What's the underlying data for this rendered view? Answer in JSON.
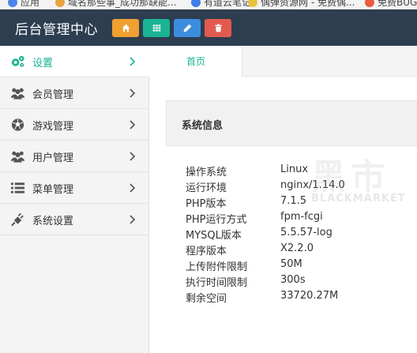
{
  "bookmarks": [
    {
      "label": "应用",
      "color": "#4a86e8"
    },
    {
      "label": "域名那些事_成功那缺能...",
      "color": "#e8a33d"
    },
    {
      "label": "有道云笔记",
      "color": "#3d7de8"
    },
    {
      "label": "偶弹资源网 - 免费偶...",
      "color": "#e8c23d"
    },
    {
      "label": "免费BUG",
      "color": "#e85b3d"
    }
  ],
  "header": {
    "title": "后台管理中心",
    "buttons": [
      {
        "icon": "home-icon",
        "color": "#f0a030"
      },
      {
        "icon": "grid-icon",
        "color": "#1ab394"
      },
      {
        "icon": "pencil-icon",
        "color": "#3c8dde"
      },
      {
        "icon": "trash-icon",
        "color": "#e25a4f"
      }
    ]
  },
  "sidebar": {
    "items": [
      {
        "label": "设置",
        "icon": "gears-icon",
        "active": true
      },
      {
        "label": "会员管理",
        "icon": "users-icon",
        "active": false
      },
      {
        "label": "游戏管理",
        "icon": "soccer-ball-icon",
        "active": false
      },
      {
        "label": "用户管理",
        "icon": "users-icon",
        "active": false
      },
      {
        "label": "菜单管理",
        "icon": "list-icon",
        "active": false
      },
      {
        "label": "系统设置",
        "icon": "plug-icon",
        "active": false
      }
    ]
  },
  "tabs": [
    {
      "label": "首页",
      "active": true
    }
  ],
  "panel": {
    "title": "系统信息",
    "rows": [
      {
        "key": "操作系统",
        "value": "Linux"
      },
      {
        "key": "运行环境",
        "value": "nginx/1.14.0"
      },
      {
        "key": "PHP版本",
        "value": "7.1.5"
      },
      {
        "key": "PHP运行方式",
        "value": "fpm-fcgi"
      },
      {
        "key": "MYSQL版本",
        "value": "5.5.57-log"
      },
      {
        "key": "程序版本",
        "value": "X2.2.0"
      },
      {
        "key": "上传附件限制",
        "value": "50M"
      },
      {
        "key": "执行时间限制",
        "value": "300s"
      },
      {
        "key": "剩余空间",
        "value": "33720.27M"
      }
    ]
  },
  "watermark": {
    "big": "黑市",
    "small": "BLACKMARKET"
  },
  "colors": {
    "accent": "#1ab394",
    "header_bg": "#2c3e50"
  }
}
